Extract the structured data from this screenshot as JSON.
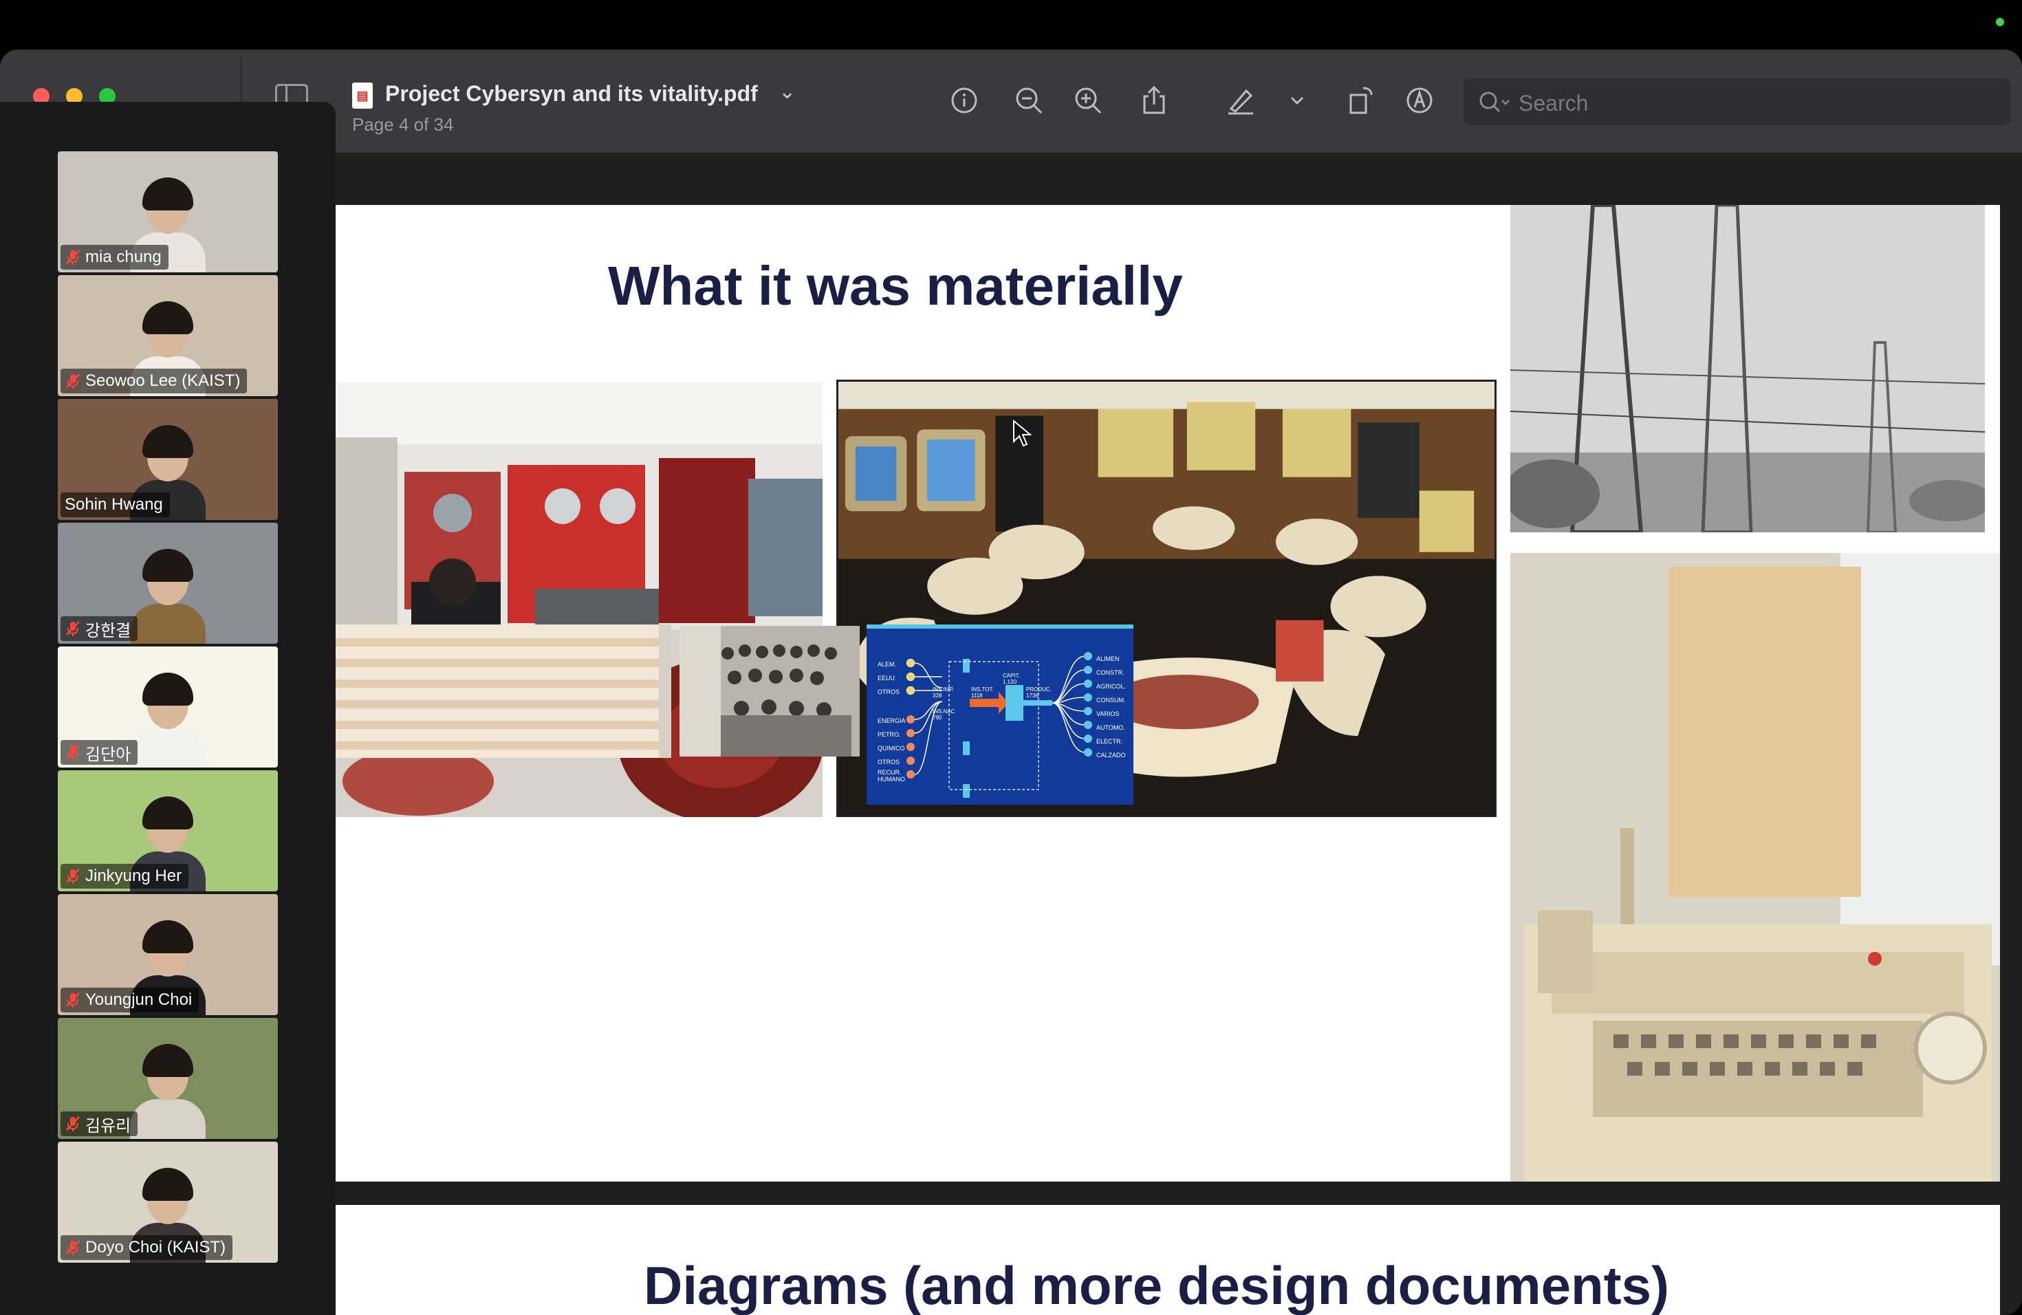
{
  "document": {
    "title": "Project Cybersyn and its vitality.pdf",
    "page_info": "Page 4 of 34"
  },
  "toolbar": {
    "search_placeholder": "Search"
  },
  "participants": [
    {
      "name": "mia chung",
      "muted": true,
      "bg": "#c9c4bc",
      "shirt": "#e9e5de"
    },
    {
      "name": "Seowoo Lee (KAIST)",
      "muted": true,
      "bg": "#cdbfae",
      "shirt": "#f1ede6"
    },
    {
      "name": "Sohin Hwang",
      "muted": false,
      "bg": "#7a5a44",
      "shirt": "#2a2a2a",
      "active": true
    },
    {
      "name": "강한결",
      "muted": true,
      "bg": "#8a8f95",
      "shirt": "#8a6a3c"
    },
    {
      "name": "김단아",
      "muted": true,
      "bg": "#f7f5ea",
      "shirt": "#f2f2ef"
    },
    {
      "name": "Jinkyung Her",
      "muted": true,
      "bg": "#a8c87a",
      "shirt": "#3a3d44"
    },
    {
      "name": "Youngjun Choi",
      "muted": true,
      "bg": "#cbb9a5",
      "shirt": "#1e1e20"
    },
    {
      "name": "김유리",
      "muted": true,
      "bg": "#7d8f5e",
      "shirt": "#d9d2c6"
    },
    {
      "name": "Doyo Choi (KAIST)",
      "muted": true,
      "bg": "#d9d4c6",
      "shirt": "#3a3534"
    }
  ],
  "slides": {
    "current_title": "What it was materially",
    "next_title": "Diagrams (and more design documents)"
  },
  "flow_diagram": {
    "inputs": [
      "ALEM.",
      "EEUU",
      "OTROS",
      "ENERGIA",
      "PETRO.",
      "QUIMICO",
      "OTROS",
      "RECUR. HUMANO"
    ],
    "ins_imp": "INS.IMP. 328",
    "ins_nac": "INS.NAC 790",
    "ins_tot": "INS.TOT. 1118",
    "capit": "CAPIT. 1.130",
    "produc": "PRODUC. 1736",
    "outputs": [
      "ALIMEN",
      "CONSTR.",
      "AGRICOL.",
      "CONSUM.",
      "VARIOS",
      "AUTOMO.",
      "ELECTR.",
      "CALZADO"
    ]
  }
}
